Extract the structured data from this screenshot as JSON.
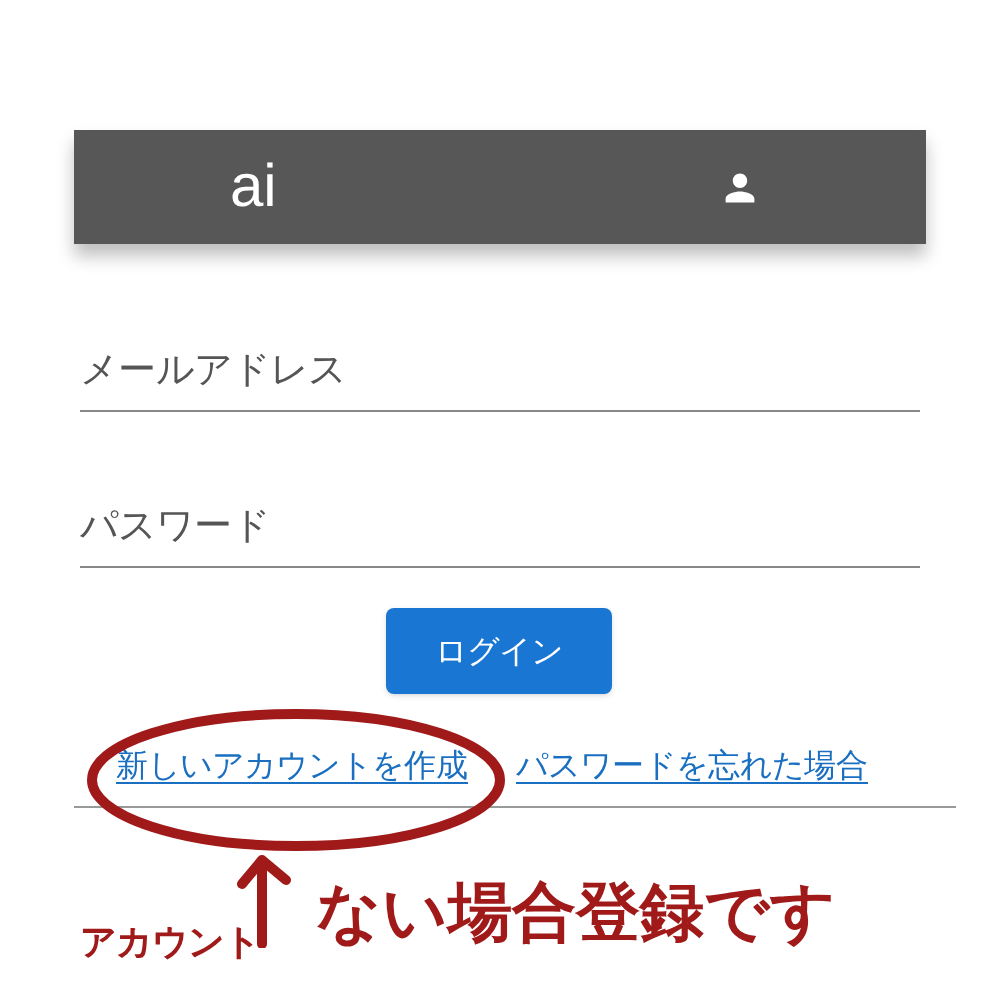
{
  "header": {
    "logo": "ai"
  },
  "fields": [
    {
      "placeholder": "メールアドレス"
    },
    {
      "placeholder": "パスワード"
    }
  ],
  "login_button": "ログイン",
  "links": [
    "新しいアカウントを作成",
    "パスワードを忘れた場合"
  ],
  "annotation": {
    "label": "アカウント",
    "note": "ない場合登録です"
  }
}
